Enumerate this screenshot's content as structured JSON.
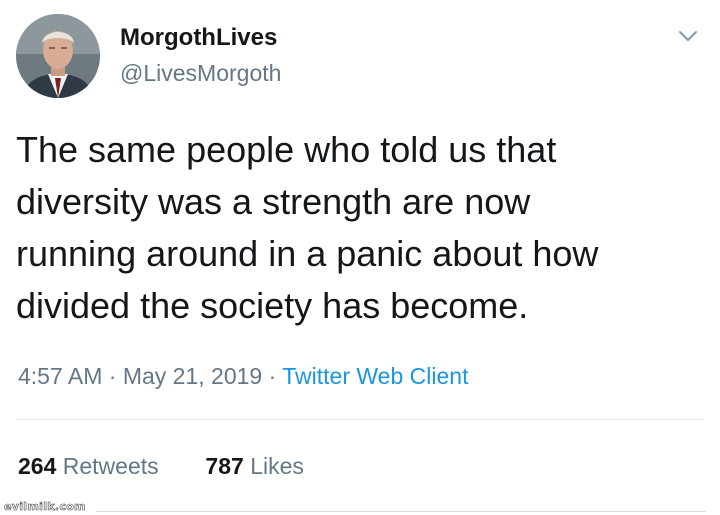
{
  "user": {
    "display_name": "MorgothLives",
    "handle": "@LivesMorgoth",
    "avatar_icon": "profile-photo"
  },
  "tweet": {
    "lines": [
      "The same people who told us that",
      "diversity was a strength are now",
      "running around in a panic about how",
      "divided the society has become."
    ],
    "time": "4:57 AM",
    "separator": "·",
    "date": "May 21, 2019",
    "source": "Twitter Web Client"
  },
  "stats": {
    "retweets_count": "264",
    "retweets_label": "Retweets",
    "likes_count": "787",
    "likes_label": "Likes"
  },
  "menu_icon": "chevron-down-icon",
  "watermark": "evilmilk.com",
  "colors": {
    "text": "#14171a",
    "secondary": "#657786",
    "link": "#1b95e0",
    "divider": "#e1e8ed"
  }
}
